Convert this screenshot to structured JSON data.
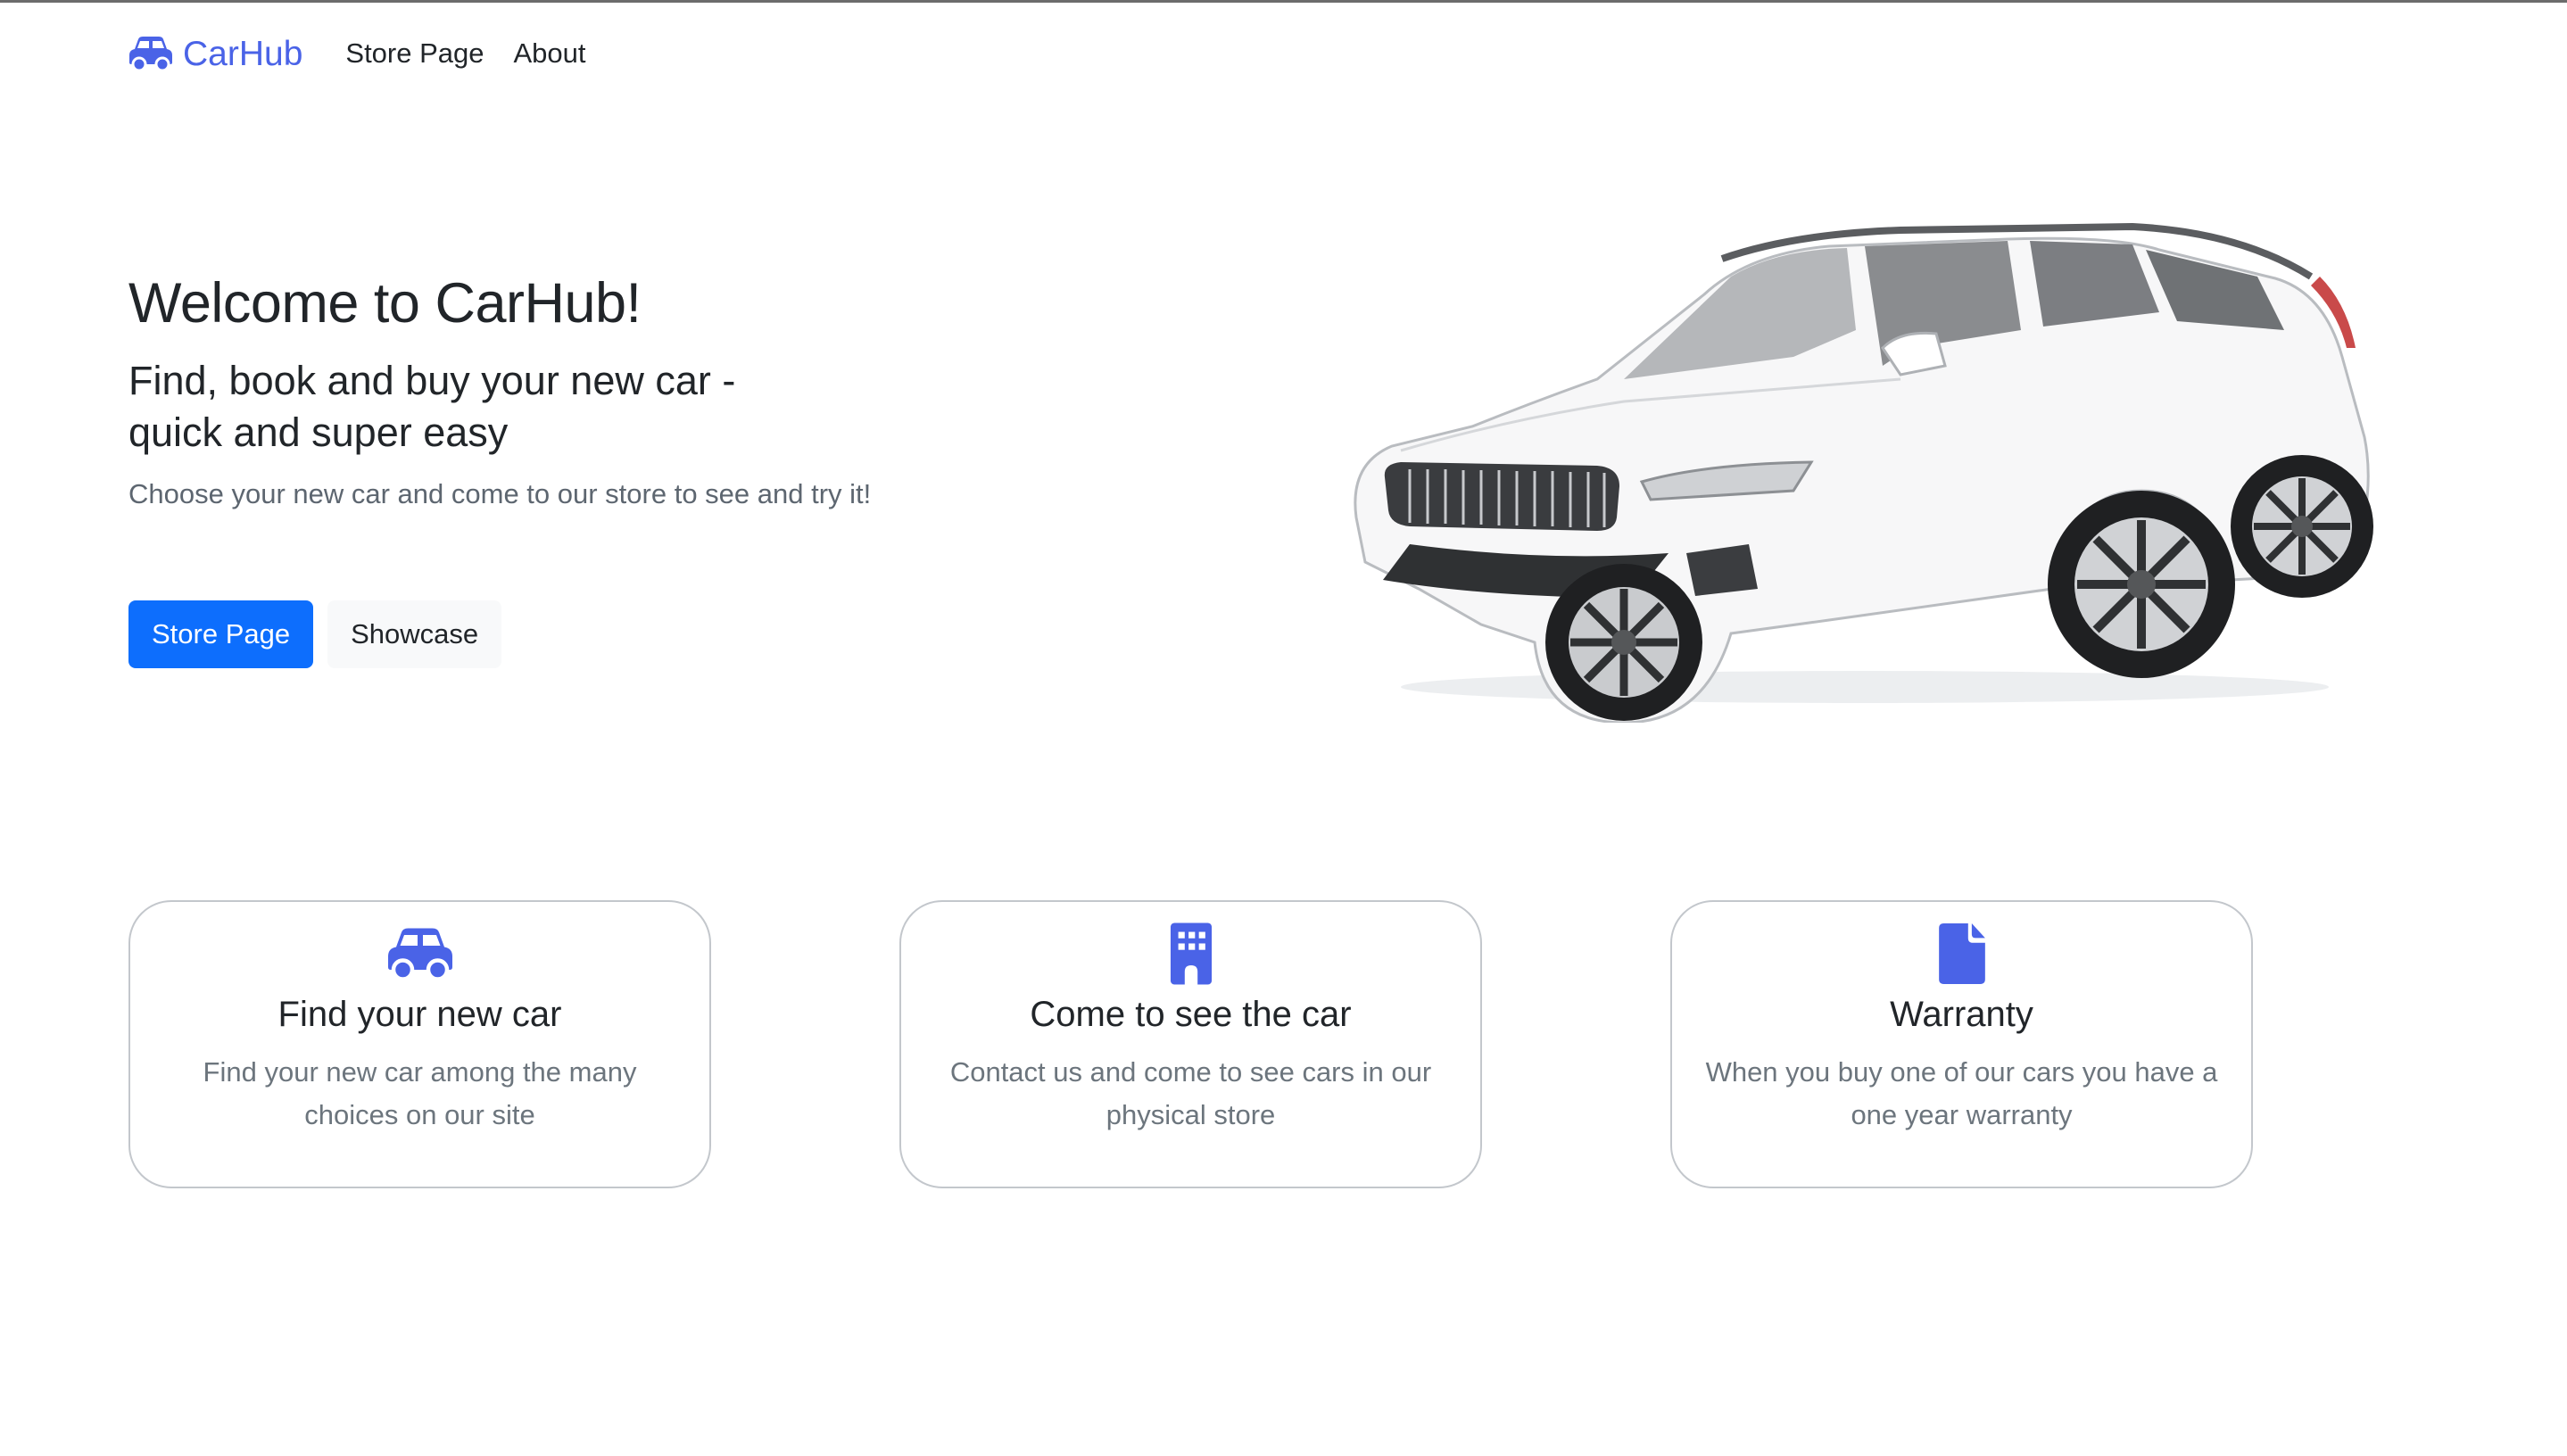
{
  "colors": {
    "accent": "#4a63e7",
    "primary_button": "#0d6efd",
    "light_button": "#f8f9fa",
    "muted_text": "#6c757d"
  },
  "navbar": {
    "brand_icon": "car-icon",
    "brand_label": "CarHub",
    "links": [
      "Store Page",
      "About"
    ]
  },
  "hero": {
    "title": "Welcome to CarHub!",
    "subtitle_line1": "Find, book and buy your new car -",
    "subtitle_line2": "quick and super easy",
    "description": "Choose your new car and come to our store to see and try it!",
    "primary_button": "Store Page",
    "secondary_button": "Showcase",
    "image": "white-station-wagon-car"
  },
  "features": [
    {
      "icon": "car-icon",
      "title": "Find your new car",
      "text": "Find your new car among the many choices on our site"
    },
    {
      "icon": "building-icon",
      "title": "Come to see the car",
      "text": "Contact us and come to see cars in our physical store"
    },
    {
      "icon": "file-icon",
      "title": "Warranty",
      "text": "When you buy one of our cars you have a one year warranty"
    }
  ]
}
